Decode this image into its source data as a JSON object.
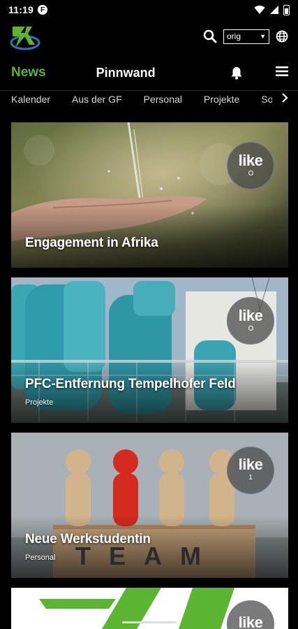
{
  "status_bar": {
    "time": "11:19",
    "app_badge": "F",
    "icons": [
      "wifi-icon",
      "signal-icon",
      "battery-icon"
    ]
  },
  "header": {
    "logo_text": "K",
    "language_select": {
      "value": "orig"
    },
    "icons": [
      "search-icon",
      "globe-icon"
    ]
  },
  "nav": {
    "news": "News",
    "pinnwand": "Pinnwand",
    "icons": [
      "bell-icon",
      "menu-icon"
    ]
  },
  "tabs": [
    "Kalender",
    "Aus der GF",
    "Personal",
    "Projekte",
    "So"
  ],
  "cards": [
    {
      "title": "Engagement in Afrika",
      "category": "",
      "like_label": "like",
      "like_count": ""
    },
    {
      "title": "PFC-Entfernung Tempelhofer Feld",
      "category": "Projekte",
      "like_label": "like",
      "like_count": ""
    },
    {
      "title": "Neue Werkstudentin",
      "category": "Personal",
      "like_label": "like",
      "like_count": "1",
      "image_text": "TEAM"
    },
    {
      "title": "",
      "category": "",
      "like_label": "like",
      "like_count": ""
    }
  ],
  "colors": {
    "accent": "#5cb531",
    "background": "#000000",
    "logo_blue": "#1f7ac2"
  }
}
